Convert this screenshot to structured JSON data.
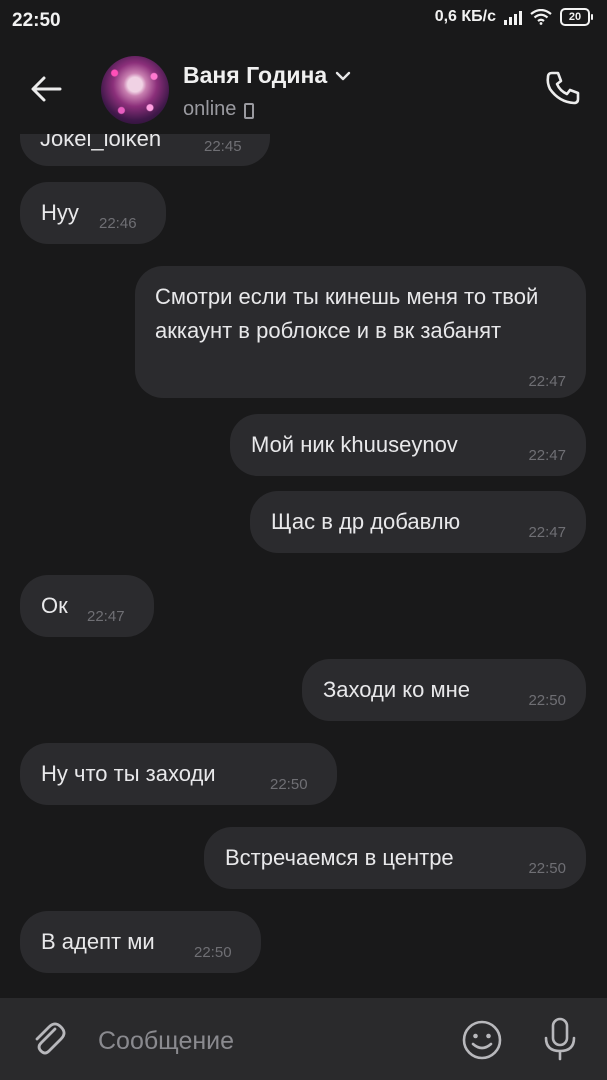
{
  "status_bar": {
    "time": "22:50",
    "network_speed": "0,6 КБ/с",
    "battery": "20"
  },
  "header": {
    "contact_name": "Ваня Година",
    "presence": "online"
  },
  "messages": [
    {
      "side": "in",
      "text": "Jokel_lolken",
      "time": "22:45"
    },
    {
      "side": "in",
      "text": "Нуу",
      "time": "22:46"
    },
    {
      "side": "out",
      "text": "Смотри если ты кинешь меня то твой аккаунт в роблоксе и в вк забанят",
      "time": "22:47"
    },
    {
      "side": "out",
      "text": "Мой ник khuuseynov",
      "time": "22:47"
    },
    {
      "side": "out",
      "text": "Щас в др добавлю",
      "time": "22:47"
    },
    {
      "side": "in",
      "text": "Ок",
      "time": "22:47"
    },
    {
      "side": "out",
      "text": "Заходи ко мне",
      "time": "22:50"
    },
    {
      "side": "in",
      "text": "Ну что ты заходи",
      "time": "22:50"
    },
    {
      "side": "out",
      "text": "Встречаемся в центре",
      "time": "22:50"
    },
    {
      "side": "in",
      "text": "В адепт ми",
      "time": "22:50"
    }
  ],
  "composer": {
    "placeholder": "Сообщение"
  },
  "icons": {
    "back": "arrow-left-icon",
    "call": "phone-icon",
    "attach": "paperclip-icon",
    "emoji": "smile-icon",
    "voice": "microphone-icon"
  }
}
